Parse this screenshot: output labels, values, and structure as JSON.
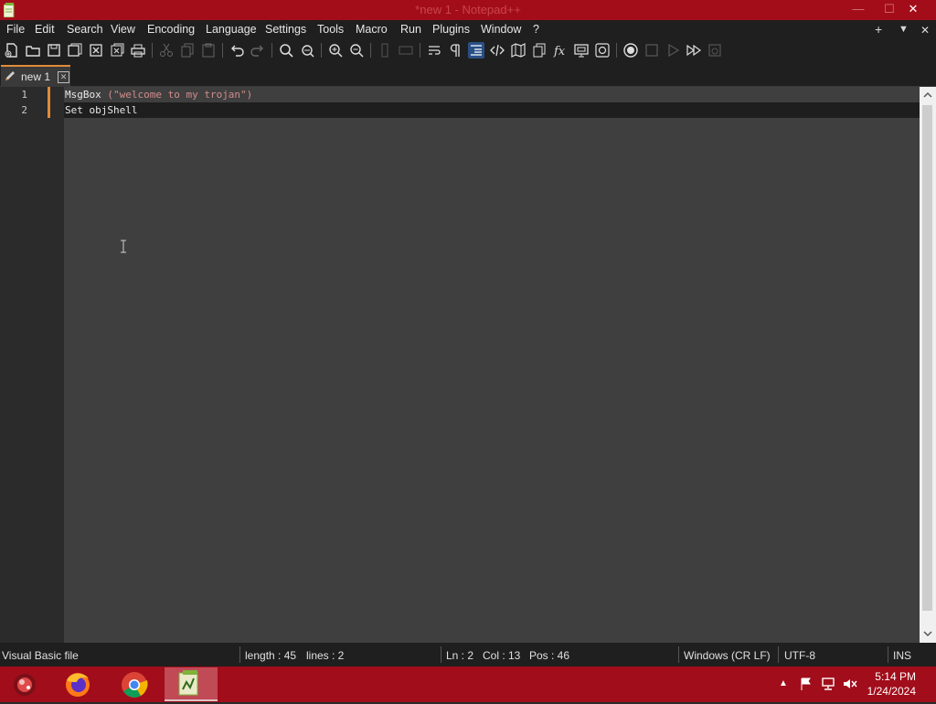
{
  "window": {
    "title": "*new 1 - Notepad++",
    "minimize": "—",
    "maximize": "☐",
    "close": "✕"
  },
  "menu": [
    "File",
    "Edit",
    "Search",
    "View",
    "Encoding",
    "Language",
    "Settings",
    "Tools",
    "Macro",
    "Run",
    "Plugins",
    "Window",
    "?"
  ],
  "menu_right": {
    "add": "+",
    "dropdown": "▼",
    "close": "✕"
  },
  "toolbar_icons": [
    "new-file-icon",
    "open-file-icon",
    "save-icon",
    "save-all-icon",
    "close-icon",
    "close-all-icon",
    "print-icon",
    "cut-icon",
    "copy-icon",
    "paste-icon",
    "undo-icon",
    "redo-icon",
    "find-icon",
    "replace-icon",
    "zoom-in-icon",
    "zoom-out-icon",
    "sync-vertical-icon",
    "sync-horizontal-icon",
    "word-wrap-icon",
    "show-all-chars-icon",
    "indent-guide-icon",
    "xml-tag-icon",
    "document-map-icon",
    "document-list-icon",
    "function-list-icon",
    "folder-workspace-icon",
    "monitoring-icon",
    "record-macro-icon",
    "stop-macro-icon",
    "play-macro-icon",
    "run-macro-multiple-icon",
    "save-macro-icon"
  ],
  "tab": {
    "name": "new 1",
    "close": "✕"
  },
  "editor": {
    "lines": [
      {
        "num": "1",
        "kw": "MsgBox ",
        "str": "(\"welcome to my trojan\")"
      },
      {
        "num": "2",
        "kw": "Set objShell",
        "str": ""
      }
    ]
  },
  "status": {
    "filetype": "Visual Basic file",
    "length": "length : 45",
    "lines": "lines : 2",
    "ln": "Ln : 2",
    "col": "Col : 13",
    "pos": "Pos : 46",
    "eol": "Windows (CR LF)",
    "encoding": "UTF-8",
    "mode": "INS"
  },
  "taskbar": {
    "apps": [
      "start-button",
      "firefox",
      "chrome",
      "notepad-plus-plus"
    ],
    "time": "5:14 PM",
    "date": "1/24/2024",
    "tray_arrow": "▲"
  },
  "colors": {
    "accent": "#e08b3a",
    "titlebar": "#a30d1a",
    "taskbar": "#a10d1a"
  }
}
